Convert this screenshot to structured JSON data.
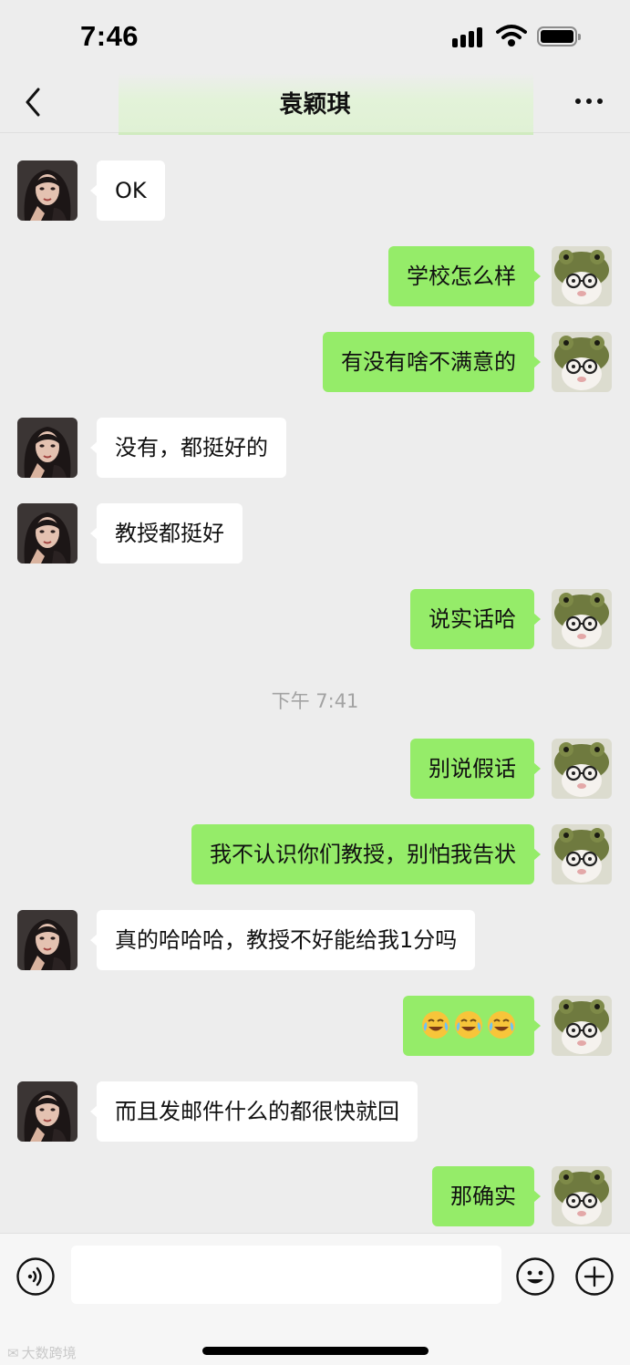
{
  "status_bar": {
    "time": "7:46"
  },
  "header": {
    "title": "袁颖琪"
  },
  "messages": [
    {
      "side": "left",
      "text": "OK"
    },
    {
      "side": "right",
      "text": "学校怎么样"
    },
    {
      "side": "right",
      "text": "有没有啥不满意的"
    },
    {
      "side": "left",
      "text": "没有，都挺好的"
    },
    {
      "side": "left",
      "text": "教授都挺好"
    },
    {
      "side": "right",
      "text": "说实话哈"
    },
    {
      "side": "divider",
      "text": "下午 7:41"
    },
    {
      "side": "right",
      "text": "别说假话"
    },
    {
      "side": "right",
      "text": "我不认识你们教授，别怕我告状"
    },
    {
      "side": "left",
      "text": "真的哈哈哈，教授不好能给我1分吗"
    },
    {
      "side": "right",
      "emoji": [
        "tears-of-joy-emoji",
        "tears-of-joy-emoji",
        "tears-of-joy-emoji"
      ]
    },
    {
      "side": "left",
      "text": "而且发邮件什么的都很快就回"
    },
    {
      "side": "right",
      "text": "那确实"
    }
  ],
  "input": {
    "value": "",
    "placeholder": ""
  },
  "watermark": {
    "text": "大数跨境"
  },
  "colors": {
    "background": "#ededed",
    "outgoing_bubble": "#95ec69",
    "incoming_bubble": "#ffffff",
    "input_bar": "#f6f6f6"
  },
  "icons": {
    "back": "chevron-left-icon",
    "more": "more-dots-icon",
    "voice": "voice-icon",
    "emoji": "emoji-smile-icon",
    "plus": "plus-icon"
  }
}
